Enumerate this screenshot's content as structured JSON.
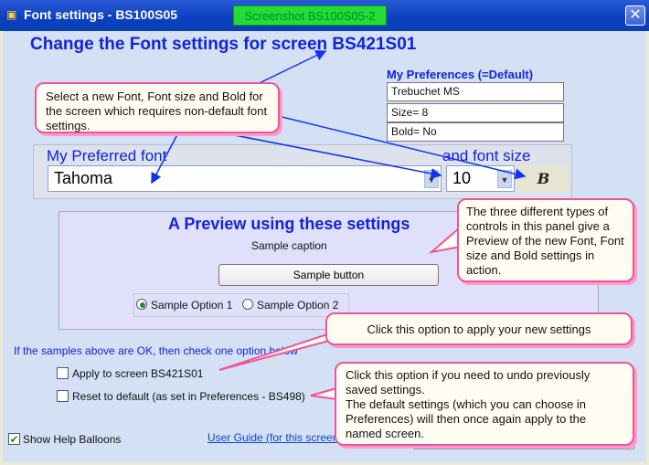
{
  "window": {
    "title": "Font settings - BS100S05",
    "tag": "Screenshot BS100S05-2",
    "close_glyph": "✕"
  },
  "heading": "Change the Font settings for screen BS421S01",
  "preferences": {
    "label": "My Preferences (=Default)",
    "font": "Trebuchet MS",
    "size": "Size= 8",
    "bold": "Bold= No"
  },
  "font_panel": {
    "font_label": "My Preferred font",
    "size_label": "and font size",
    "font_value": "Tahoma",
    "size_value": "10",
    "bold_glyph": "B"
  },
  "preview": {
    "title": "A Preview using these settings",
    "caption": "Sample caption",
    "button_label": "Sample button",
    "option1": "Sample Option 1",
    "option2": "Sample Option 2",
    "selected_option": 1
  },
  "apply_section": {
    "note": "If the samples above are OK, then check one option below",
    "apply_label": "Apply to screen BS421S01",
    "reset_label": "Reset to default (as set in  Preferences - BS498)"
  },
  "footer": {
    "show_help_label": "Show Help Balloons",
    "show_help_checked": true,
    "user_guide_link": "User Guide (for this screen)"
  },
  "callouts": {
    "c1": "Select a new Font, Font size and Bold for the screen which requires non-default font settings.",
    "c2": "The three different types of controls in this panel give a Preview of the new Font, Font size and Bold settings in action.",
    "c3": "Click this option to apply your new settings",
    "c4_line1": "Click this option if you need to undo previously saved settings.",
    "c4_line2": "The default settings (which you can choose in Preferences) will then once again apply to the named screen."
  },
  "colors": {
    "accent_blue": "#1122dd",
    "callout_border": "#ee5599",
    "tag_green": "#22dd33"
  },
  "icons": {
    "app": "font-app-icon",
    "close": "close-icon",
    "dropdown": "chevron-down-icon"
  }
}
